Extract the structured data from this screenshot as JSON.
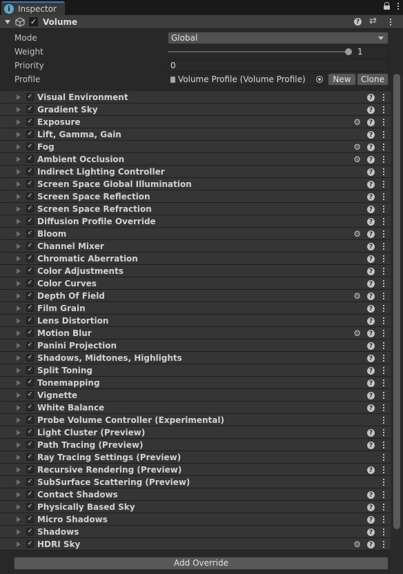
{
  "tab": {
    "title": "Inspector"
  },
  "component": {
    "title": "Volume"
  },
  "properties": {
    "mode_label": "Mode",
    "mode_value": "Global",
    "weight_label": "Weight",
    "weight_value": "1",
    "weight_fraction": 1.0,
    "priority_label": "Priority",
    "priority_value": "0",
    "profile_label": "Profile",
    "profile_value": "Volume Profile (Volume Profile)",
    "new_label": "New",
    "clone_label": "Clone"
  },
  "overrides": [
    {
      "label": "Visual Environment",
      "advanced": false,
      "help": true
    },
    {
      "label": "Gradient Sky",
      "advanced": false,
      "help": true
    },
    {
      "label": "Exposure",
      "advanced": true,
      "help": true
    },
    {
      "label": "Lift, Gamma, Gain",
      "advanced": false,
      "help": true
    },
    {
      "label": "Fog",
      "advanced": true,
      "help": true
    },
    {
      "label": "Ambient Occlusion",
      "advanced": true,
      "help": true
    },
    {
      "label": "Indirect Lighting Controller",
      "advanced": false,
      "help": true
    },
    {
      "label": "Screen Space Global Illumination",
      "advanced": false,
      "help": true
    },
    {
      "label": "Screen Space Reflection",
      "advanced": false,
      "help": true
    },
    {
      "label": "Screen Space Refraction",
      "advanced": false,
      "help": true
    },
    {
      "label": "Diffusion Profile Override",
      "advanced": false,
      "help": true
    },
    {
      "label": "Bloom",
      "advanced": true,
      "help": true
    },
    {
      "label": "Channel Mixer",
      "advanced": false,
      "help": true
    },
    {
      "label": "Chromatic Aberration",
      "advanced": false,
      "help": true
    },
    {
      "label": "Color Adjustments",
      "advanced": false,
      "help": true
    },
    {
      "label": "Color Curves",
      "advanced": false,
      "help": true
    },
    {
      "label": "Depth Of Field",
      "advanced": true,
      "help": true
    },
    {
      "label": "Film Grain",
      "advanced": false,
      "help": true
    },
    {
      "label": "Lens Distortion",
      "advanced": false,
      "help": true
    },
    {
      "label": "Motion Blur",
      "advanced": true,
      "help": true
    },
    {
      "label": "Panini Projection",
      "advanced": false,
      "help": true
    },
    {
      "label": "Shadows, Midtones, Highlights",
      "advanced": false,
      "help": true
    },
    {
      "label": "Split Toning",
      "advanced": false,
      "help": true
    },
    {
      "label": "Tonemapping",
      "advanced": false,
      "help": true
    },
    {
      "label": "Vignette",
      "advanced": false,
      "help": true
    },
    {
      "label": "White Balance",
      "advanced": false,
      "help": true
    },
    {
      "label": "Probe Volume Controller (Experimental)",
      "advanced": false,
      "help": false
    },
    {
      "label": "Light Cluster (Preview)",
      "advanced": false,
      "help": true
    },
    {
      "label": "Path Tracing (Preview)",
      "advanced": false,
      "help": true
    },
    {
      "label": "Ray Tracing Settings (Preview)",
      "advanced": false,
      "help": false
    },
    {
      "label": "Recursive Rendering (Preview)",
      "advanced": false,
      "help": true
    },
    {
      "label": "SubSurface Scattering (Preview)",
      "advanced": false,
      "help": false
    },
    {
      "label": "Contact Shadows",
      "advanced": false,
      "help": true
    },
    {
      "label": "Physically Based Sky",
      "advanced": false,
      "help": true
    },
    {
      "label": "Micro Shadows",
      "advanced": false,
      "help": true
    },
    {
      "label": "Shadows",
      "advanced": false,
      "help": true
    },
    {
      "label": "HDRI Sky",
      "advanced": true,
      "help": true
    }
  ],
  "add_override_label": "Add Override",
  "colors": {
    "accent": "#3a79bb",
    "panel": "#282828",
    "row": "#353535"
  }
}
